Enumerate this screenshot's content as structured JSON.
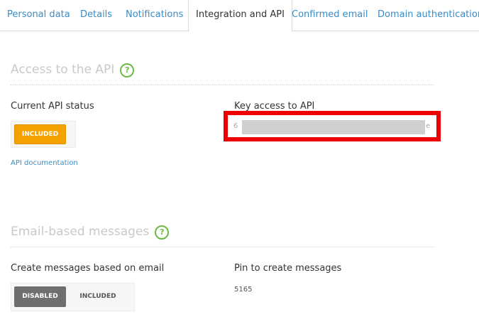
{
  "tabs": [
    {
      "label": "Personal data"
    },
    {
      "label": "Details"
    },
    {
      "label": "Notifications"
    },
    {
      "label": "Integration and API"
    },
    {
      "label": "Confirmed email"
    },
    {
      "label": "Domain authentication"
    }
  ],
  "api_section": {
    "title": "Access to the API",
    "status_label": "Current API status",
    "status_button": "INCLUDED",
    "doc_link": "API documentation",
    "key_label": "Key access to API",
    "key_visible_start": "6",
    "key_visible_end": "e"
  },
  "email_section": {
    "title": "Email-based messages",
    "create_label": "Create messages based on email",
    "toggle_disabled": "DISABLED",
    "toggle_included": "INCLUDED",
    "pin_label": "Pin to create messages",
    "pin_value": "5165"
  },
  "icons": {
    "help": "question-circle-icon"
  },
  "colors": {
    "accent_link": "#3a8cc4",
    "included_orange": "#f5a200",
    "disabled_gray": "#6e6e6e",
    "help_green": "#6bbb45",
    "highlight_red": "#ee0000"
  }
}
